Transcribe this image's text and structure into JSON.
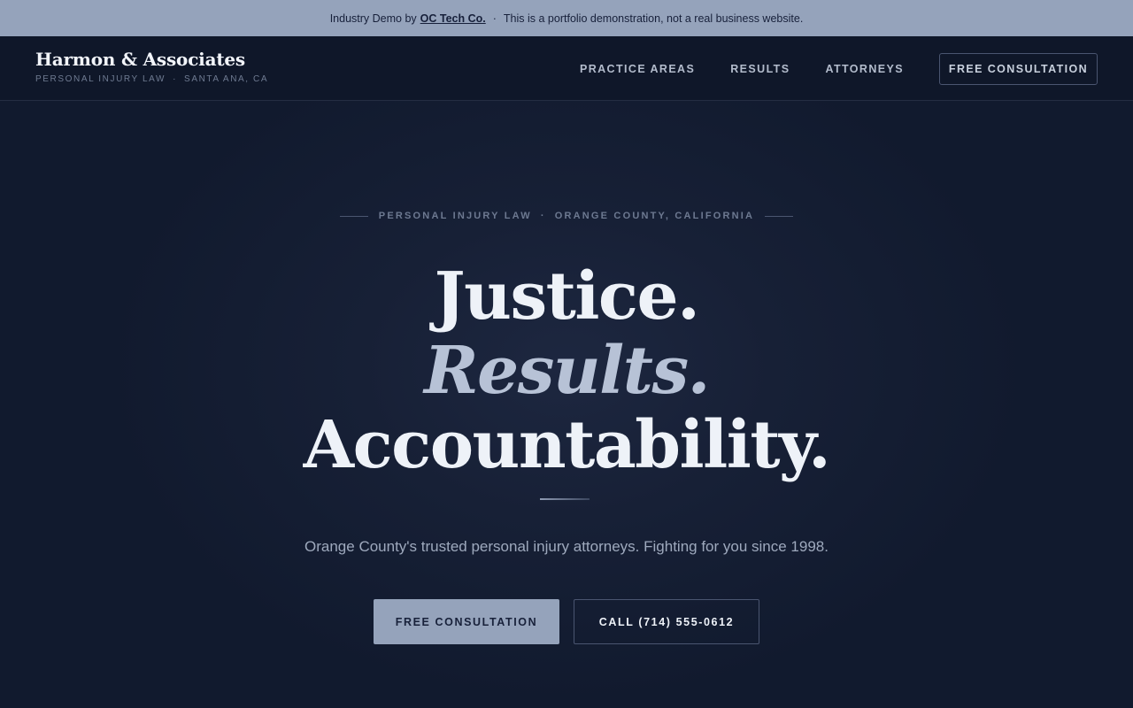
{
  "banner": {
    "prefix": "Industry Demo by",
    "link": "OC Tech Co.",
    "separator": "·",
    "message": "This is a portfolio demonstration, not a real business website."
  },
  "brand": {
    "name": "Harmon & Associates",
    "sub_left": "PERSONAL INJURY LAW",
    "sub_sep": "·",
    "sub_right": "SANTA ANA, CA"
  },
  "nav": {
    "links": [
      "PRACTICE AREAS",
      "RESULTS",
      "ATTORNEYS"
    ],
    "cta": "FREE CONSULTATION"
  },
  "hero": {
    "eyebrow_left": "PERSONAL INJURY LAW",
    "eyebrow_sep": "·",
    "eyebrow_right": "ORANGE COUNTY, CALIFORNIA",
    "line1": "Justice.",
    "line2": "Results.",
    "line3": "Accountability.",
    "tagline": "Orange County's trusted personal injury attorneys. Fighting for you since 1998.",
    "primary_button": "FREE CONSULTATION",
    "secondary_button": "CALL (714) 555-0612"
  },
  "colors": {
    "banner_bg": "#95a3bb",
    "page_bg": "#121a2d",
    "accent": "#95a3bb"
  }
}
